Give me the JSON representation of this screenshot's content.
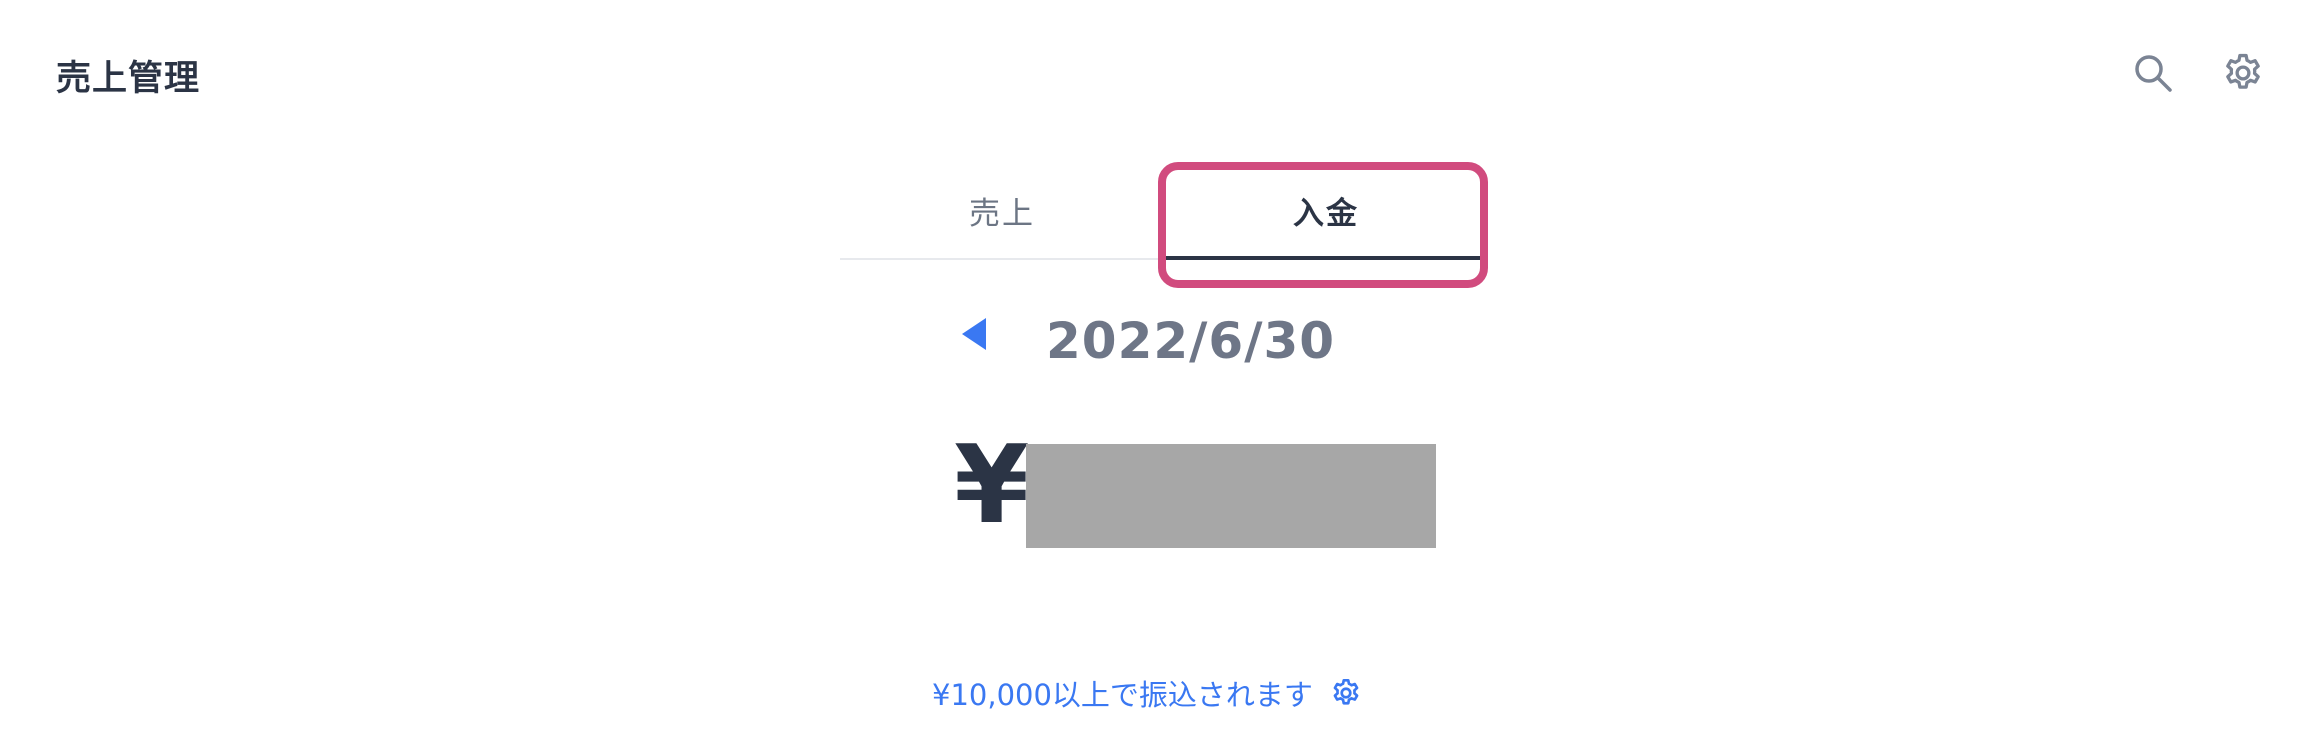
{
  "header": {
    "title": "売上管理",
    "icons": [
      "search-icon",
      "gear-icon"
    ]
  },
  "tabs": [
    {
      "label": "売上",
      "selected": false
    },
    {
      "label": "入金",
      "selected": true
    }
  ],
  "date_nav": {
    "date": "2022/6/30",
    "prev_icon": "triangle-left-icon"
  },
  "amount": {
    "currency_symbol": "¥"
  },
  "threshold_note": {
    "text": "¥10,000以上で振込されます",
    "icon": "gear-icon"
  },
  "colors": {
    "primary_text": "#2b3445",
    "accent_blue": "#3a78f2",
    "highlight": "#d14b7e",
    "muted_text": "#6e7687"
  }
}
